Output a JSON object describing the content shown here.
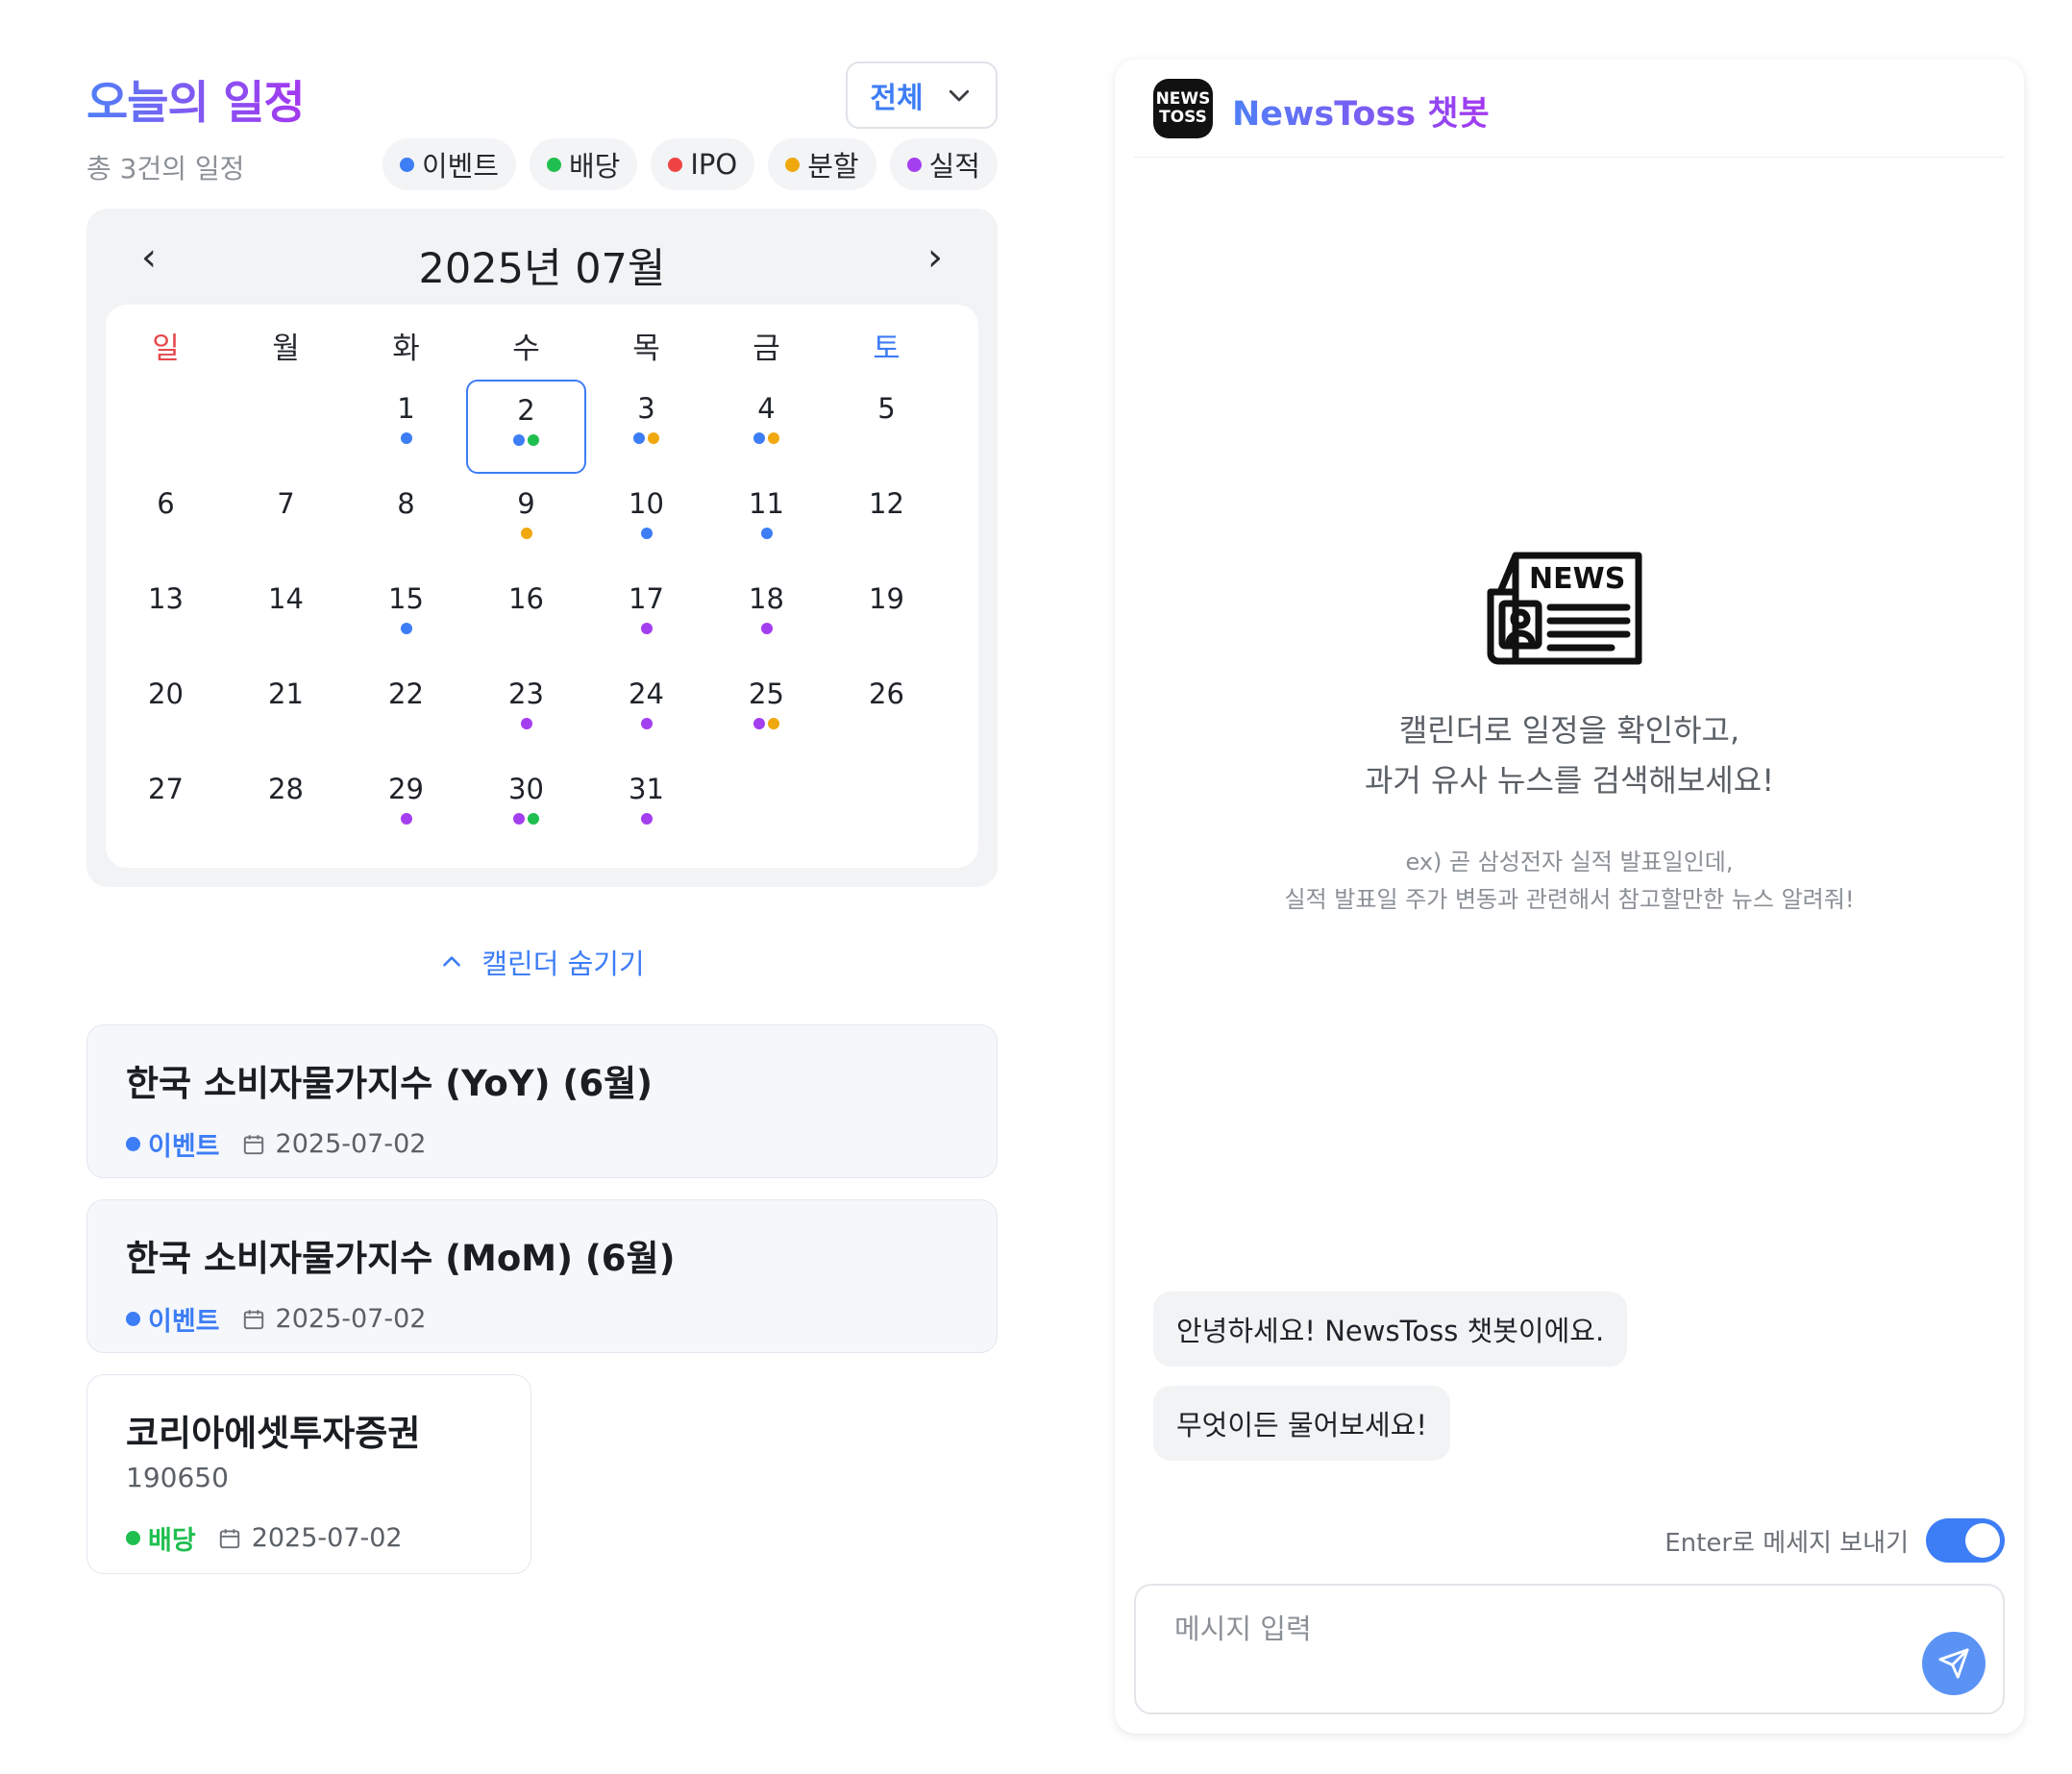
{
  "schedule": {
    "title": "오늘의 일정",
    "subtitle": "총 3건의 일정",
    "filter": {
      "selected": "전체"
    },
    "legend": [
      {
        "label": "이벤트",
        "color": "#3d7df5"
      },
      {
        "label": "배당",
        "color": "#1fbf4f"
      },
      {
        "label": "IPO",
        "color": "#ef4444"
      },
      {
        "label": "분할",
        "color": "#f0a80f"
      },
      {
        "label": "실적",
        "color": "#a43ff0"
      }
    ]
  },
  "calendar": {
    "month_label": "2025년 07월",
    "prev": "‹",
    "next": "›",
    "weekdays": [
      "일",
      "월",
      "화",
      "수",
      "목",
      "금",
      "토"
    ],
    "first_weekday_index": 2,
    "days_in_month": 31,
    "selected_day": 2,
    "event_dots": {
      "1": [
        "event"
      ],
      "2": [
        "event",
        "dividend"
      ],
      "3": [
        "event",
        "split"
      ],
      "4": [
        "event",
        "split"
      ],
      "9": [
        "split"
      ],
      "10": [
        "event"
      ],
      "11": [
        "event"
      ],
      "15": [
        "event"
      ],
      "17": [
        "earnings"
      ],
      "18": [
        "earnings"
      ],
      "23": [
        "earnings"
      ],
      "24": [
        "earnings"
      ],
      "25": [
        "earnings",
        "split"
      ],
      "29": [
        "earnings"
      ],
      "30": [
        "earnings",
        "dividend"
      ],
      "31": [
        "earnings"
      ]
    },
    "dot_colors": {
      "event": "#3d7df5",
      "dividend": "#1fbf4f",
      "ipo": "#ef4444",
      "split": "#f0a80f",
      "earnings": "#a43ff0"
    },
    "toggle_label": "캘린더 숨기기"
  },
  "events": [
    {
      "title": "한국 소비자물가지수 (YoY) (6월)",
      "tag": "이벤트",
      "tag_color": "#3d7df5",
      "date": "2025-07-02"
    },
    {
      "title": "한국 소비자물가지수 (MoM) (6월)",
      "tag": "이벤트",
      "tag_color": "#3d7df5",
      "date": "2025-07-02"
    },
    {
      "title": "코리아에셋투자증권",
      "code": "190650",
      "tag": "배당",
      "tag_color": "#1fbf4f",
      "date": "2025-07-02"
    }
  ],
  "chat": {
    "logo_text": "NEWS TOSS",
    "title": "NewsToss 챗봇",
    "intro_line1": "캘린더로 일정을 확인하고,",
    "intro_line2": "과거 유사 뉴스를 검색해보세요!",
    "example_line1": "ex) 곧 삼성전자 실적 발표일인데,",
    "example_line2": "실적 발표일 주가 변동과 관련해서 참고할만한 뉴스 알려줘!",
    "messages": [
      "안녕하세요! NewsToss 챗봇이에요.",
      "무엇이든 물어보세요!"
    ],
    "enter_to_send_label": "Enter로 메세지 보내기",
    "enter_to_send_on": true,
    "input_placeholder": "메시지 입력",
    "icons": {
      "send": "send-icon",
      "news": "newspaper-icon"
    }
  }
}
